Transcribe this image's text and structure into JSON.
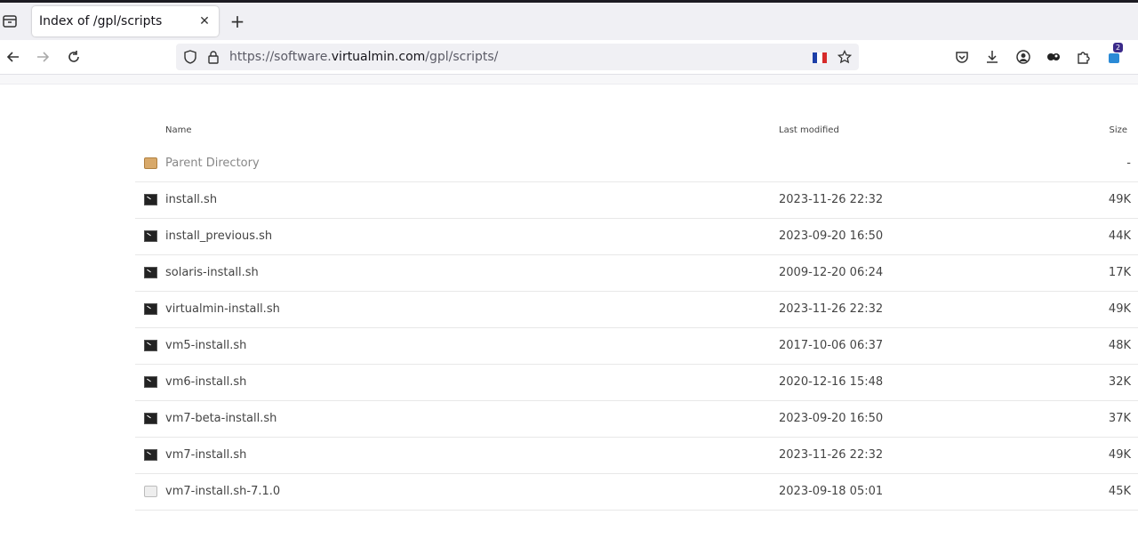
{
  "tab": {
    "title": "Index of /gpl/scripts",
    "close": "✕",
    "new_tab": "+"
  },
  "url": {
    "prefix": "https://software.",
    "domain": "virtualmin.com",
    "path": "/gpl/scripts/"
  },
  "colors": {
    "flag": [
      "#1d3fa8",
      "#ffffff",
      "#d62a2a"
    ]
  },
  "listing": {
    "headers": {
      "name": "Name",
      "modified": "Last modified",
      "size": "Size"
    },
    "rows": [
      {
        "icon": "folder-up-icon",
        "name": "Parent Directory",
        "modified": "",
        "size": "-"
      },
      {
        "icon": "terminal-icon",
        "name": "install.sh",
        "modified": "2023-11-26 22:32",
        "size": "49K"
      },
      {
        "icon": "terminal-icon",
        "name": "install_previous.sh",
        "modified": "2023-09-20 16:50",
        "size": "44K"
      },
      {
        "icon": "terminal-icon",
        "name": "solaris-install.sh",
        "modified": "2009-12-20 06:24",
        "size": "17K"
      },
      {
        "icon": "terminal-icon",
        "name": "virtualmin-install.sh",
        "modified": "2023-11-26 22:32",
        "size": "49K"
      },
      {
        "icon": "terminal-icon",
        "name": "vm5-install.sh",
        "modified": "2017-10-06 06:37",
        "size": "48K"
      },
      {
        "icon": "terminal-icon",
        "name": "vm6-install.sh",
        "modified": "2020-12-16 15:48",
        "size": "32K"
      },
      {
        "icon": "terminal-icon",
        "name": "vm7-beta-install.sh",
        "modified": "2023-09-20 16:50",
        "size": "37K"
      },
      {
        "icon": "terminal-icon",
        "name": "vm7-install.sh",
        "modified": "2023-11-26 22:32",
        "size": "49K"
      },
      {
        "icon": "file-icon",
        "name": "vm7-install.sh-7.1.0",
        "modified": "2023-09-18 05:01",
        "size": "45K"
      }
    ]
  },
  "extensions_badge": "2"
}
